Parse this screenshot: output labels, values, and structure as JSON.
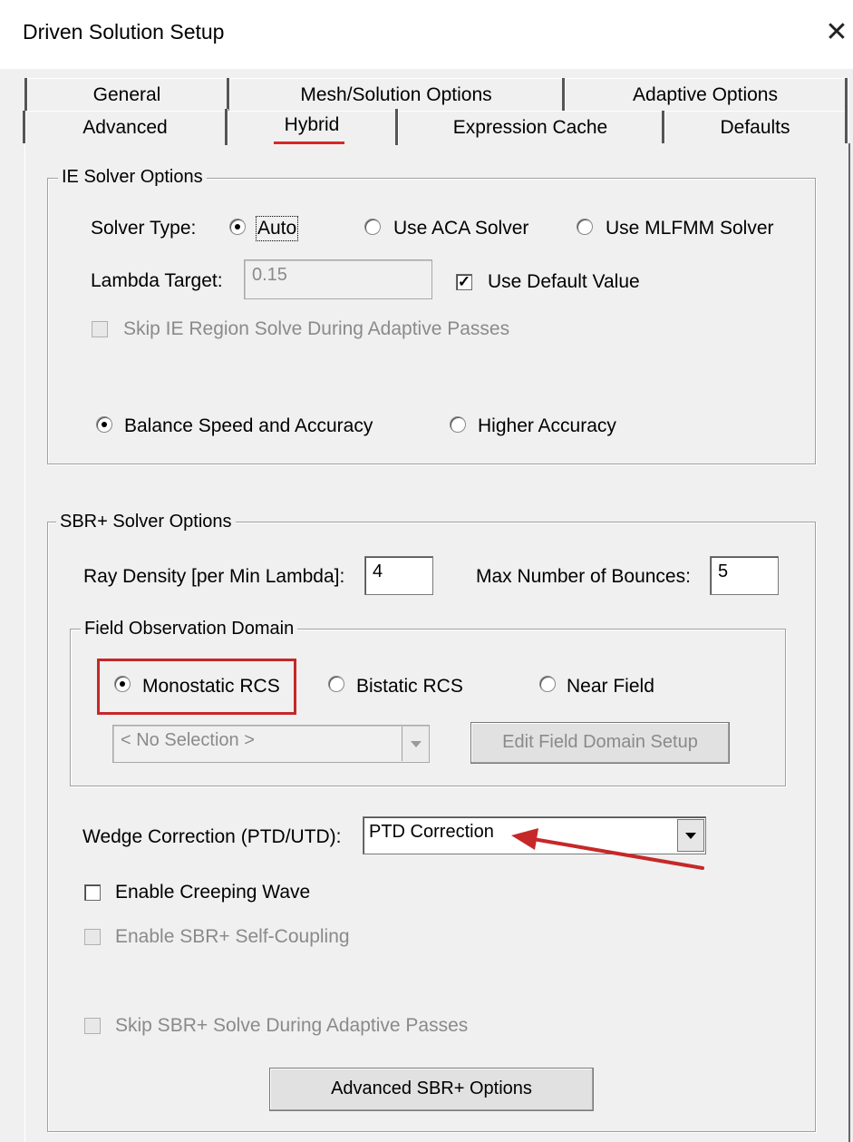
{
  "window": {
    "title": "Driven Solution Setup",
    "close_glyph": "✕"
  },
  "tabs": {
    "row1": [
      "General",
      "Mesh/Solution Options",
      "Adaptive Options"
    ],
    "row2": [
      "Advanced",
      "Hybrid",
      "Expression Cache",
      "Defaults"
    ],
    "active": "Hybrid"
  },
  "ie": {
    "group_label": "IE Solver Options",
    "solver_type_label": "Solver Type:",
    "solver_options": [
      "Auto",
      "Use ACA Solver",
      "Use MLFMM Solver"
    ],
    "solver_selected": "Auto",
    "lambda_label": "Lambda Target:",
    "lambda_value": "0.15",
    "use_default_label": "Use Default Value",
    "use_default_checked": true,
    "skip_label": "Skip IE Region Solve During Adaptive Passes",
    "accuracy_options": [
      "Balance Speed and Accuracy",
      "Higher Accuracy"
    ],
    "accuracy_selected": "Balance Speed and Accuracy"
  },
  "sbr": {
    "group_label": "SBR+ Solver Options",
    "ray_density_label": "Ray Density [per Min Lambda]:",
    "ray_density_value": "4",
    "max_bounces_label": "Max Number of Bounces:",
    "max_bounces_value": "5",
    "field_domain_label": "Field Observation Domain",
    "domain_options": [
      "Monostatic RCS",
      "Bistatic RCS",
      "Near Field"
    ],
    "domain_selected": "Monostatic RCS",
    "domain_select_value": "< No Selection >",
    "edit_domain_label": "Edit Field Domain Setup",
    "wedge_label": "Wedge Correction (PTD/UTD):",
    "wedge_value": "PTD Correction",
    "creeping_label": "Enable Creeping Wave",
    "self_coupling_label": "Enable SBR+ Self-Coupling",
    "skip_label": "Skip SBR+ Solve During Adaptive Passes",
    "advanced_button": "Advanced SBR+ Options"
  },
  "annotation_color": "#c62828"
}
